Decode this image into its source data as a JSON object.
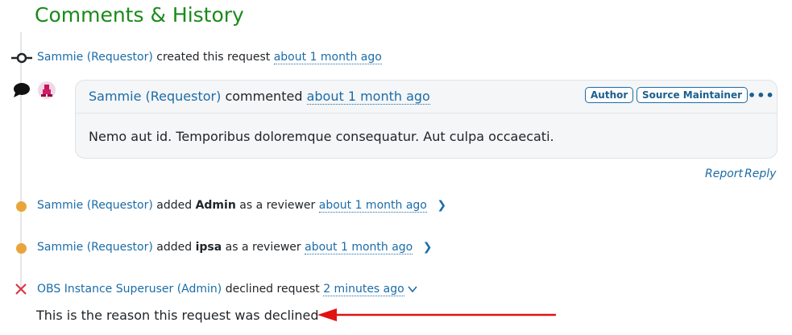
{
  "section_title": "Comments & History",
  "timeline": {
    "created": {
      "user": "Sammie (Requestor)",
      "action": "created this request",
      "time": "about 1 month ago"
    },
    "comment": {
      "user": "Sammie (Requestor)",
      "action": "commented",
      "time": "about 1 month ago",
      "badges": [
        "Author",
        "Source Maintainer"
      ],
      "menu_label": "•••",
      "body": "Nemo aut id. Temporibus doloremque consequatur. Aut culpa occaecati.",
      "actions": {
        "report": "Report",
        "reply": "Reply"
      }
    },
    "reviewer1": {
      "user": "Sammie (Requestor)",
      "pre": "added",
      "name": "Admin",
      "post": "as a reviewer",
      "time": "about 1 month ago"
    },
    "reviewer2": {
      "user": "Sammie (Requestor)",
      "pre": "added",
      "name": "ipsa",
      "post": "as a reviewer",
      "time": "about 1 month ago"
    },
    "declined": {
      "user": "OBS Instance Superuser (Admin)",
      "action": "declined request",
      "time": "2 minutes ago",
      "reason": "This is the reason this request was declined"
    }
  },
  "colors": {
    "title_green": "#1a8a1a",
    "link_blue": "#1b6ca8",
    "dot_orange": "#e9a53b",
    "declined_red": "#dc3545",
    "arrow_red": "#e11212"
  },
  "icons": {
    "created": "commit-icon",
    "comment": "speech-bubble-icon",
    "review": "dot-icon",
    "declined": "x-icon",
    "expand": "chevron-right-icon",
    "collapse": "chevron-down-icon"
  }
}
